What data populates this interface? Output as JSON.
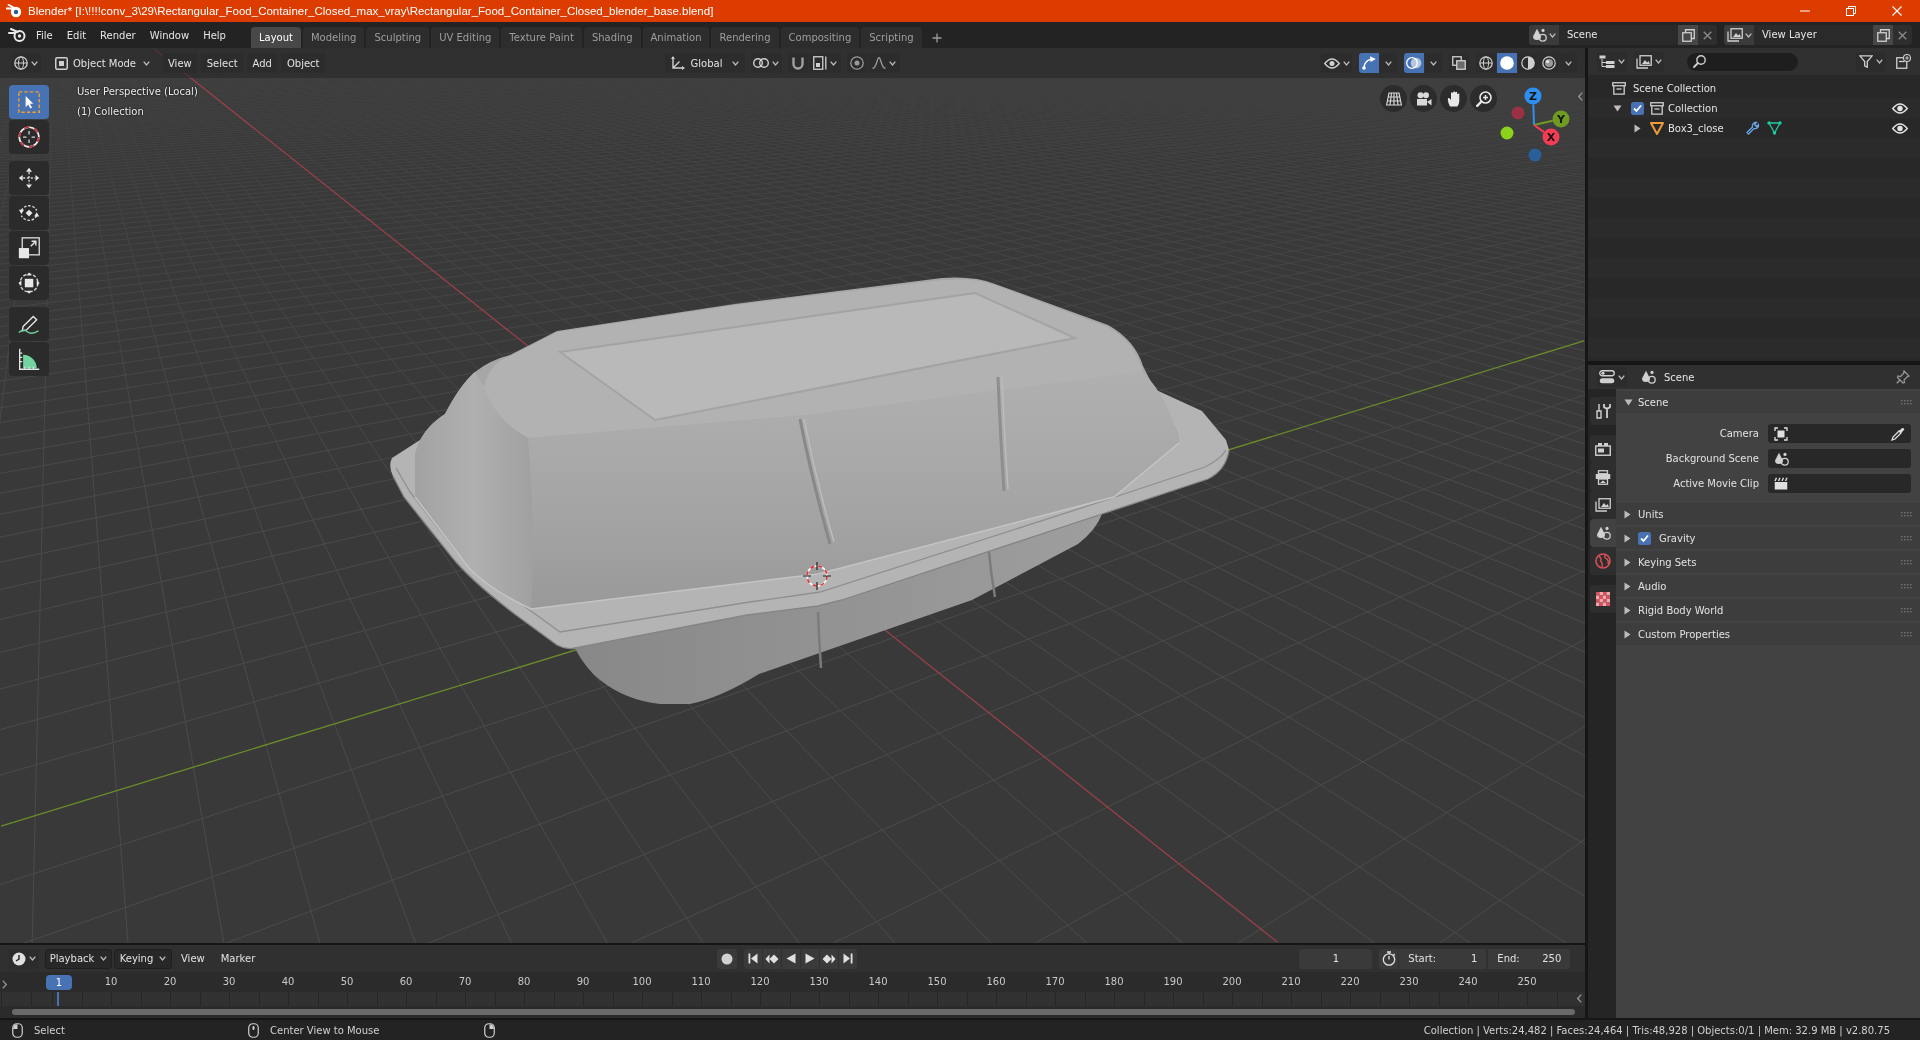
{
  "window": {
    "title": "Blender* [I:\\!!!!conv_3\\29\\Rectangular_Food_Container_Closed_max_vray\\Rectangular_Food_Container_Closed_blender_base.blend]"
  },
  "menu": [
    "File",
    "Edit",
    "Render",
    "Window",
    "Help"
  ],
  "workspaces": [
    {
      "label": "Layout",
      "selected": true
    },
    {
      "label": "Modeling",
      "selected": false
    },
    {
      "label": "Sculpting",
      "selected": false
    },
    {
      "label": "UV Editing",
      "selected": false
    },
    {
      "label": "Texture Paint",
      "selected": false
    },
    {
      "label": "Shading",
      "selected": false
    },
    {
      "label": "Animation",
      "selected": false
    },
    {
      "label": "Rendering",
      "selected": false
    },
    {
      "label": "Compositing",
      "selected": false
    },
    {
      "label": "Scripting",
      "selected": false
    }
  ],
  "scene": {
    "value": "Scene"
  },
  "view_layer": {
    "value": "View Layer"
  },
  "viewport": {
    "mode": "Object Mode",
    "menus": [
      "View",
      "Select",
      "Add",
      "Object"
    ],
    "orientation": "Global",
    "gizmos_on": true,
    "overlays_on": true,
    "xray_on": false,
    "shading": [
      {
        "kind": "wireframe",
        "selected": false
      },
      {
        "kind": "solid",
        "selected": true
      },
      {
        "kind": "material",
        "selected": false
      },
      {
        "kind": "rendered",
        "selected": false
      }
    ],
    "tool_groups": [
      {
        "tools": [
          {
            "kind": "select_box",
            "selected": true
          },
          {
            "kind": "cursor",
            "selected": false
          }
        ]
      },
      {
        "tools": [
          {
            "kind": "move",
            "selected": false
          },
          {
            "kind": "rotate",
            "selected": false
          },
          {
            "kind": "scale",
            "selected": false
          },
          {
            "kind": "transform",
            "selected": false
          }
        ]
      },
      {
        "tools": [
          {
            "kind": "annotate",
            "selected": false
          },
          {
            "kind": "measure",
            "selected": false
          }
        ]
      }
    ],
    "info": [
      "User Perspective (Local)",
      "(1) Collection"
    ],
    "axes": [
      {
        "kind": "negative",
        "color": "#9b3243"
      },
      {
        "kind": "negative",
        "color": "#8cd11c"
      },
      {
        "kind": "negative",
        "color": "#2a5f99"
      },
      {
        "kind": "positive",
        "label": "Z",
        "color": "#2e8ff0"
      },
      {
        "kind": "positive",
        "label": "Y",
        "color": "#6f9b22"
      },
      {
        "kind": "positive",
        "label": "X",
        "color": "#f43c55"
      }
    ]
  },
  "outliner": {
    "root": "Scene Collection",
    "items": [
      {
        "kind": "collection",
        "label": "Collection",
        "expanded": true,
        "checked": true,
        "visible": true,
        "children": [
          {
            "kind": "mesh",
            "label": "Box3_close",
            "expanded": false,
            "visible": true,
            "badges": [
              {
                "kind": "modifier"
              },
              {
                "kind": "mesh_data"
              }
            ]
          }
        ]
      }
    ]
  },
  "properties": {
    "context": "Scene",
    "tab_groups": [
      {
        "tabs": [
          {
            "kind": "tool",
            "selected": false
          }
        ]
      },
      {
        "tabs": [
          {
            "kind": "render",
            "selected": false
          },
          {
            "kind": "output",
            "selected": false
          },
          {
            "kind": "view_layer",
            "selected": false
          },
          {
            "kind": "scene",
            "selected": true
          },
          {
            "kind": "world",
            "selected": false
          }
        ]
      },
      {
        "tabs": [
          {
            "kind": "texture",
            "selected": false
          }
        ]
      }
    ],
    "panels": [
      {
        "title": "Scene",
        "expanded": true,
        "fields": [
          {
            "kind": "camera",
            "label": "Camera"
          },
          {
            "kind": "scene",
            "label": "Background Scene"
          },
          {
            "kind": "clip",
            "label": "Active Movie Clip"
          }
        ]
      },
      {
        "title": "Units",
        "expanded": false
      },
      {
        "title": "Gravity",
        "expanded": false,
        "checked": true
      },
      {
        "title": "Keying Sets",
        "expanded": false
      },
      {
        "title": "Audio",
        "expanded": false
      },
      {
        "title": "Rigid Body World",
        "expanded": false
      },
      {
        "title": "Custom Properties",
        "expanded": false
      }
    ]
  },
  "timeline": {
    "menus": [
      {
        "label": "Playback",
        "dropdown": true
      },
      {
        "label": "Keying",
        "dropdown": true
      },
      {
        "label": "View",
        "dropdown": false
      },
      {
        "label": "Marker",
        "dropdown": false
      }
    ],
    "auto_keying": false,
    "current_frame": "1",
    "start_label": "Start:",
    "start": "1",
    "end_label": "End:",
    "end": "250",
    "playhead": "1",
    "ticks": [
      "10",
      "20",
      "30",
      "40",
      "50",
      "60",
      "70",
      "80",
      "90",
      "100",
      "110",
      "120",
      "130",
      "140",
      "150",
      "160",
      "170",
      "180",
      "190",
      "200",
      "210",
      "220",
      "230",
      "240",
      "250"
    ]
  },
  "status_bar": {
    "hints": [
      {
        "kind": "left",
        "label": "Select"
      },
      {
        "kind": "middle",
        "label": "Center View to Mouse"
      },
      {
        "kind": "right"
      }
    ],
    "stats": "Collection | Verts:24,482 | Faces:24,464 | Tris:48,928 | Objects:0/1 | Mem: 32.9 MB | v2.80.75"
  }
}
